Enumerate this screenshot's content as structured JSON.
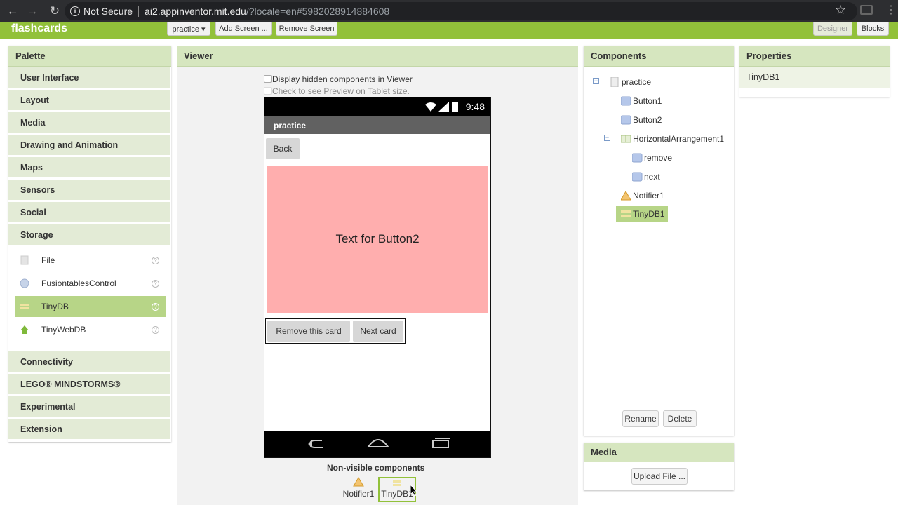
{
  "browser": {
    "security_label": "Not Secure",
    "url_host": "ai2.appinventor.mit.edu",
    "url_rest": "/?locale=en#5982028914884608"
  },
  "app": {
    "title": "flashcards",
    "screen_dropdown": "practice ▾",
    "add_screen": "Add Screen ...",
    "remove_screen": "Remove Screen",
    "designer": "Designer",
    "blocks": "Blocks",
    "accent_color": "#92c13a"
  },
  "palette": {
    "title": "Palette",
    "categories_top": [
      "User Interface",
      "Layout",
      "Media",
      "Drawing and Animation",
      "Maps",
      "Sensors",
      "Social",
      "Storage"
    ],
    "storage_items": [
      {
        "label": "File",
        "icon": "file-icon"
      },
      {
        "label": "FusiontablesControl",
        "icon": "fusiontables-icon"
      },
      {
        "label": "TinyDB",
        "icon": "tinydb-icon",
        "selected": true
      },
      {
        "label": "TinyWebDB",
        "icon": "tinywebdb-icon"
      }
    ],
    "help_glyph": "?",
    "categories_bottom": [
      "Connectivity",
      "LEGO® MINDSTORMS®",
      "Experimental",
      "Extension"
    ]
  },
  "viewer": {
    "title": "Viewer",
    "display_hidden": "Display hidden components in Viewer",
    "tablet_preview": "Check to see Preview on Tablet size.",
    "phone": {
      "clock": "9:48",
      "screen_title": "practice",
      "back_button": "Back",
      "main_button_text": "Text for Button2",
      "remove_button": "Remove this card",
      "next_button": "Next card",
      "button2_color": "#ffaeae"
    },
    "non_visible_title": "Non-visible components",
    "non_visible": [
      {
        "label": "Notifier1",
        "icon": "warning-icon"
      },
      {
        "label": "TinyDB1",
        "icon": "tinydb-icon",
        "selected": true
      }
    ]
  },
  "components": {
    "title": "Components",
    "tree": [
      {
        "label": "practice",
        "icon": "screen-icon",
        "level": 0,
        "collapsible": true
      },
      {
        "label": "Button1",
        "icon": "button-icon",
        "level": 1
      },
      {
        "label": "Button2",
        "icon": "button-icon",
        "level": 1
      },
      {
        "label": "HorizontalArrangement1",
        "icon": "horizontal-arrangement-icon",
        "level": 1,
        "collapsible": true
      },
      {
        "label": "remove",
        "icon": "button-icon",
        "level": 2
      },
      {
        "label": "next",
        "icon": "button-icon",
        "level": 2
      },
      {
        "label": "Notifier1",
        "icon": "warning-icon",
        "level": 1
      },
      {
        "label": "TinyDB1",
        "icon": "tinydb-icon",
        "level": 1,
        "selected": true
      }
    ],
    "toggle_glyph": "−",
    "rename": "Rename",
    "delete": "Delete"
  },
  "media": {
    "title": "Media",
    "upload": "Upload File ..."
  },
  "properties": {
    "title": "Properties",
    "component_name": "TinyDB1"
  }
}
